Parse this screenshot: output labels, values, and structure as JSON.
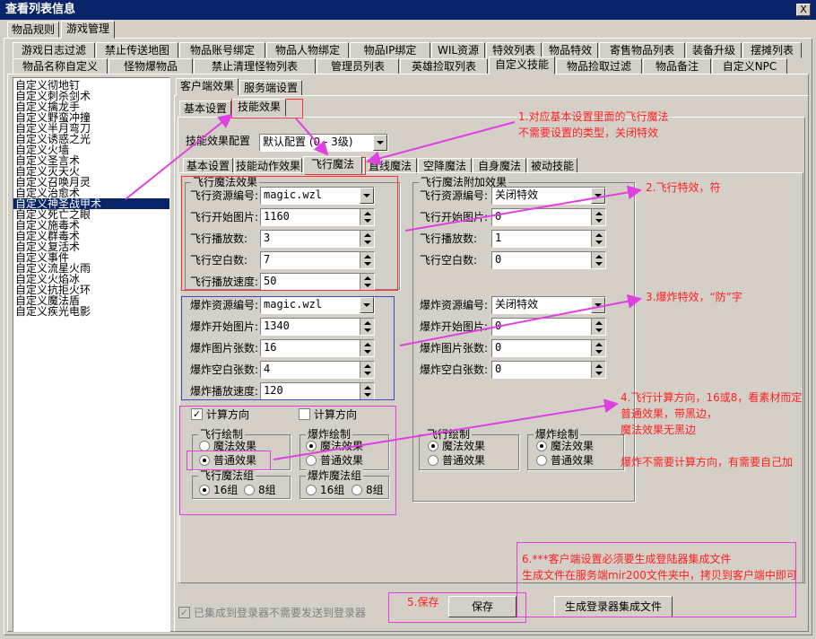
{
  "window": {
    "title": "查看列表信息",
    "close": "X"
  },
  "top_tabs": [
    "物品规则",
    "游戏管理"
  ],
  "row1_tabs": [
    "游戏日志过滤",
    "禁止传送地图",
    "物品账号绑定",
    "物品人物绑定",
    "物品IP绑定",
    "WIL资源",
    "特效列表",
    "物品特效",
    "寄售物品列表",
    "装备升级",
    "摆摊列表"
  ],
  "row2_tabs": [
    "物品名称自定义",
    "怪物爆物品",
    "禁止清理怪物列表",
    "管理员列表",
    "英雄捡取列表",
    "自定义技能",
    "物品捡取过滤",
    "物品备注",
    "自定义NPC"
  ],
  "skill_list": [
    "自定义彻地钉",
    "自定义刺杀剑术",
    "自定义擒龙手",
    "自定义野蛮冲撞",
    "自定义半月弯刀",
    "自定义诱惑之光",
    "自定义火墙",
    "自定义圣言术",
    "自定义灭天火",
    "自定义召唤月灵",
    "自定义治愈术",
    "自定义神圣战甲术",
    "自定义死亡之眼",
    "自定义施毒术",
    "自定义群毒术",
    "自定义复活术",
    "自定义事件",
    "自定义流星火雨",
    "自定义火焰冰",
    "自定义抗拒火环",
    "自定义魔法盾",
    "自定义疾光电影"
  ],
  "selected_skill_index": 11,
  "effect_tabs": [
    "客户端效果",
    "服务端设置"
  ],
  "sub_tabs": [
    "基本设置",
    "技能效果"
  ],
  "config_label": "技能效果配置",
  "config_value": "默认配置 (0 - 3级)",
  "inner_tabs": [
    "基本设置",
    "技能动作效果",
    "飞行魔法",
    "直线魔法",
    "空降魔法",
    "自身魔法",
    "被动技能"
  ],
  "fly_group": {
    "title": "飞行魔法效果",
    "rows": [
      {
        "label": "飞行资源编号:",
        "value": "magic.wzl",
        "kind": "drop"
      },
      {
        "label": "飞行开始图片:",
        "value": "1160",
        "kind": "spin"
      },
      {
        "label": "飞行播放数:",
        "value": "3",
        "kind": "spin"
      },
      {
        "label": "飞行空白数:",
        "value": "7",
        "kind": "spin"
      },
      {
        "label": "飞行播放速度:",
        "value": "50",
        "kind": "spin"
      }
    ]
  },
  "explode_group": {
    "rows": [
      {
        "label": "爆炸资源编号:",
        "value": "magic.wzl",
        "kind": "drop"
      },
      {
        "label": "爆炸开始图片:",
        "value": "1340",
        "kind": "spin"
      },
      {
        "label": "爆炸图片张数:",
        "value": "16",
        "kind": "spin"
      },
      {
        "label": "爆炸空白张数:",
        "value": "4",
        "kind": "spin"
      },
      {
        "label": "爆炸播放速度:",
        "value": "120",
        "kind": "spin"
      }
    ]
  },
  "fly_extra_group": {
    "title": "飞行魔法附加效果",
    "rows": [
      {
        "label": "飞行资源编号:",
        "value": "关闭特效",
        "kind": "drop"
      },
      {
        "label": "飞行开始图片:",
        "value": "0",
        "kind": "spin"
      },
      {
        "label": "飞行播放数:",
        "value": "1",
        "kind": "spin"
      },
      {
        "label": "飞行空白数:",
        "value": "0",
        "kind": "spin"
      }
    ],
    "rows2": [
      {
        "label": "爆炸资源编号:",
        "value": "关闭特效",
        "kind": "drop"
      },
      {
        "label": "爆炸开始图片:",
        "value": "0",
        "kind": "spin"
      },
      {
        "label": "爆炸图片张数:",
        "value": "0",
        "kind": "spin"
      },
      {
        "label": "爆炸空白张数:",
        "value": "0",
        "kind": "spin"
      }
    ]
  },
  "calc_dir_left": {
    "label": "计算方向",
    "checked": true
  },
  "calc_dir_right": {
    "label": "计算方向",
    "checked": false
  },
  "draw_fly": {
    "title": "飞行绘制",
    "opt1": "魔法效果",
    "opt2": "普通效果",
    "selected": 2
  },
  "draw_explode": {
    "title": "爆炸绘制",
    "opt1": "魔法效果",
    "opt2": "普通效果",
    "selected": 1
  },
  "fly_magic_group": {
    "title": "飞行魔法组",
    "opt1": "16组",
    "opt2": "8组",
    "selected": 1
  },
  "explode_magic_group": {
    "title": "爆炸魔法组",
    "opt1": "16组",
    "opt2": "8组",
    "selected": 0
  },
  "draw_fly_r": {
    "title": "飞行绘制",
    "opt1": "魔法效果",
    "opt2": "普通效果",
    "selected": 1
  },
  "draw_explode_r": {
    "title": "爆炸绘制",
    "opt1": "魔法效果",
    "opt2": "普通效果",
    "selected": 1
  },
  "footer": {
    "integrated_label": "已集成到登录器不需要发送到登录器",
    "save": "保存",
    "generate": "生成登录器集成文件"
  },
  "annotations": {
    "a1_line1": "1.对应基本设置里面的飞行魔法",
    "a1_line2": "不需要设置的类型，关闭特效",
    "a2": "2.飞行特效，符",
    "a3": "3.爆炸特效，“防”字",
    "a4_line1": "4.飞行计算方向，16或8，看素材而定",
    "a4_line2": "普通效果，带黑边，",
    "a4_line3": "魔法效果无黑边",
    "a4_line4": "爆炸不需要计算方向，有需要自己加",
    "a5": "5.保存",
    "a6_line1": "6.***客户端设置必须要生成登陆器集成文件",
    "a6_line2": "生成文件在服务端mir200文件夹中，拷贝到客户端中即可"
  },
  "colors": {
    "annot_red": "#ff2020",
    "arrow_magenta": "#e040e0",
    "selection": "#0a246a"
  }
}
